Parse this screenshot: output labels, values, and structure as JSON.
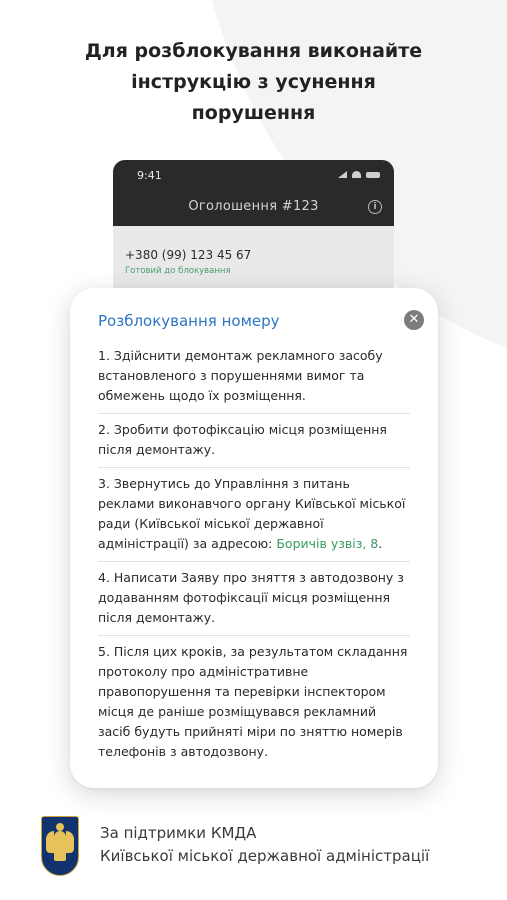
{
  "headline": {
    "line1": "Для розблокування виконайте",
    "line2": "інструкцію з усунення",
    "line3": "порушення"
  },
  "phone": {
    "status_time": "9:41",
    "nav_title": "Оголошення  #123",
    "phone_number": "+380 (99) 123 45 67",
    "phone_status": "Готовий до блокування",
    "icons": [
      "cellular-signal-icon",
      "wifi-icon",
      "battery-icon",
      "info-icon"
    ]
  },
  "modal": {
    "title": "Розблокування номеру",
    "close_icon": "close-icon",
    "steps": [
      {
        "text": "1. Здійснити демонтаж рекламного засобу встановленого з порушеннями вимог та обмежень щодо їх розміщення."
      },
      {
        "text": "2. Зробити фотофіксацію місця розміщення після демонтажу."
      },
      {
        "text": "3. Звернутись до Управління з питань реклами виконавчого органу Київської міської ради (Київської міської державної адміністрації) за адресою: ",
        "link": "Боричів узвіз, 8",
        "suffix": "."
      },
      {
        "text": "4. Написати Заяву про зняття з автодозвону з додаванням фотофіксації місця розміщення після демонтажу."
      },
      {
        "text": "5. Після цих кроків, за результатом складання протоколу про адміністративне правопорушення та перевірки інспектором місця де раніше розміщувався рекламний засіб будуть прийняті міри по зняттю номерів телефонів з автодозвону."
      }
    ]
  },
  "footer": {
    "line1": "За підтримки КМДА",
    "line2": "Київської міської державної адміністрації",
    "logo": "kyiv-coat-of-arms-icon"
  },
  "colors": {
    "accent_blue": "#2b76c4",
    "address_green": "#3b9a63",
    "status_green": "#4a9d72",
    "phone_header": "#2a2a2c"
  }
}
